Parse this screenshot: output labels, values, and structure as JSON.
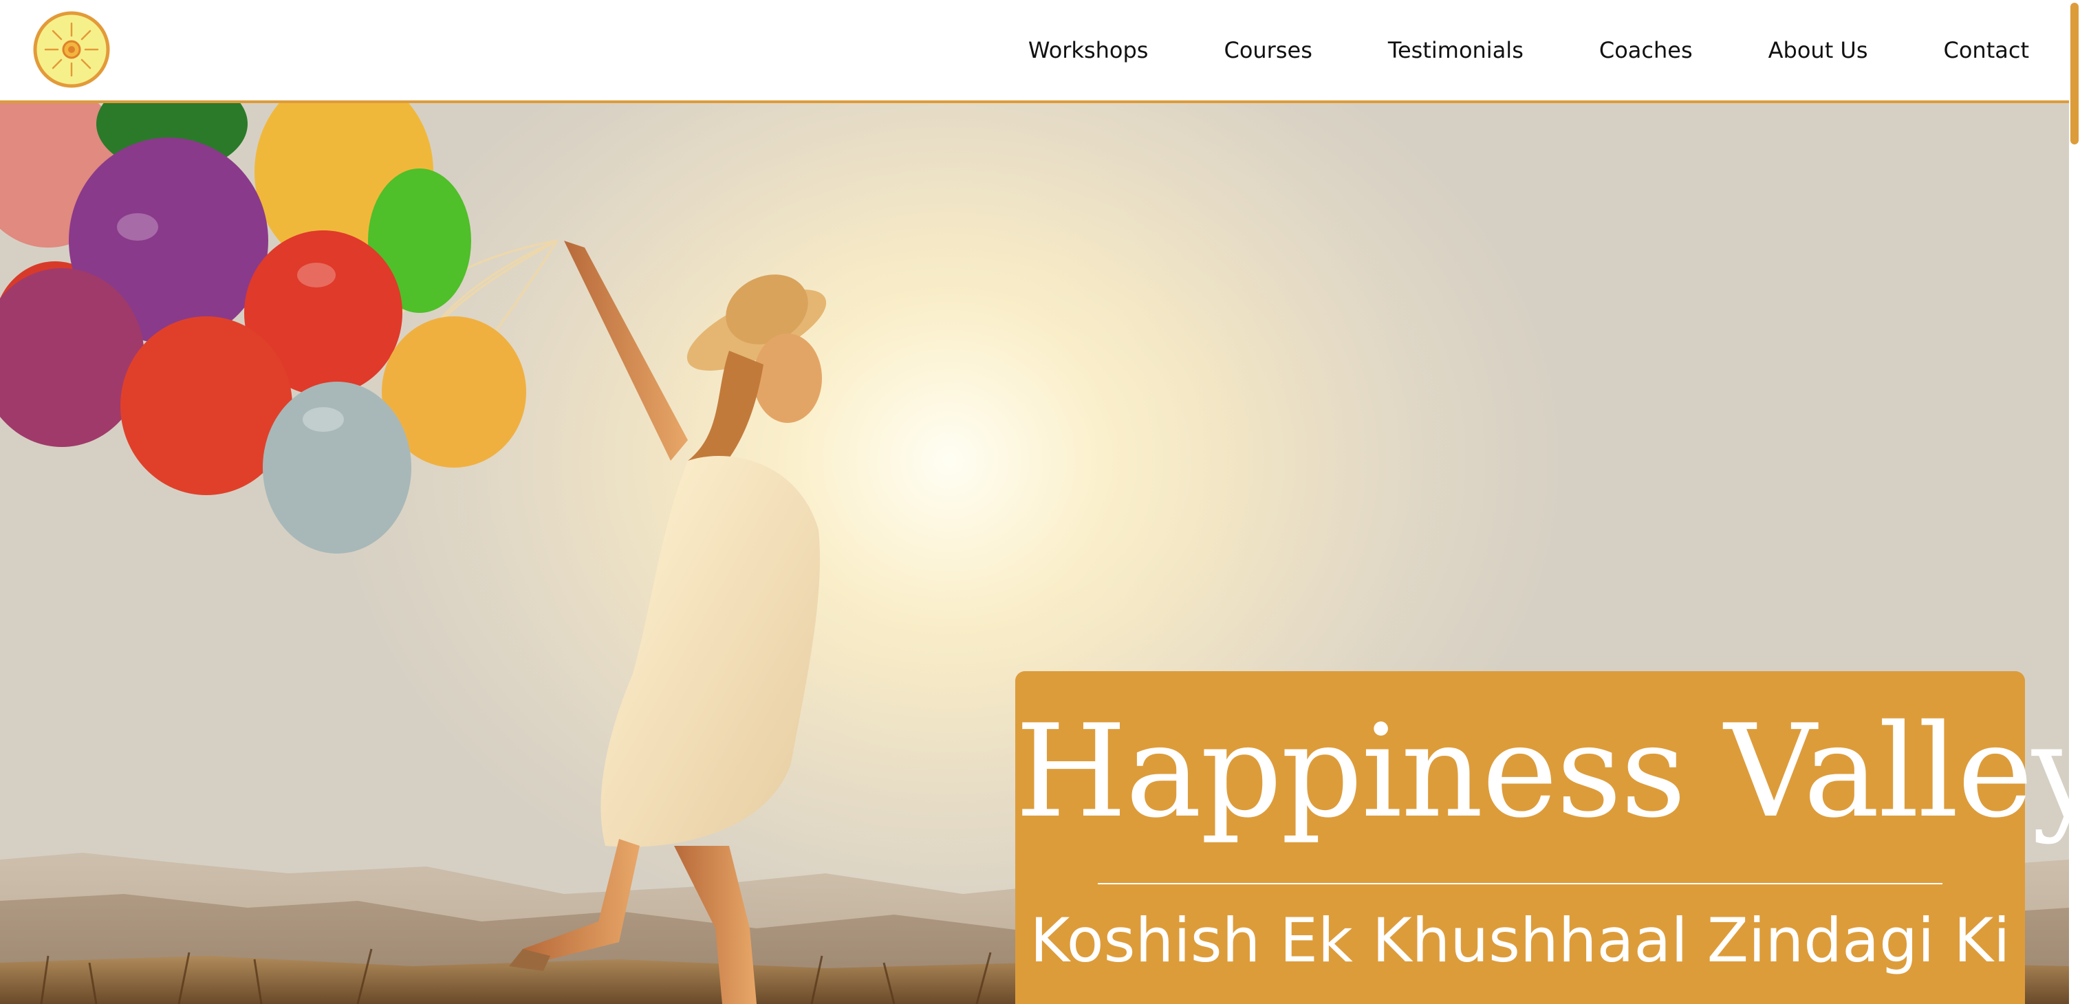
{
  "header": {
    "logo_name": "sun-logo",
    "nav": [
      {
        "label": "Workshops"
      },
      {
        "label": "Courses"
      },
      {
        "label": "Testimonials"
      },
      {
        "label": "Coaches"
      },
      {
        "label": "About Us"
      },
      {
        "label": "Contact"
      }
    ]
  },
  "hero": {
    "title": "Happiness Valley",
    "subtitle": "Koshish Ek Khushhaal Zindagi Ki"
  },
  "colors": {
    "accent": "#dd9c3a",
    "header_bg": "#ffffff",
    "text_dark": "#111111",
    "card_text": "#ffffff"
  }
}
